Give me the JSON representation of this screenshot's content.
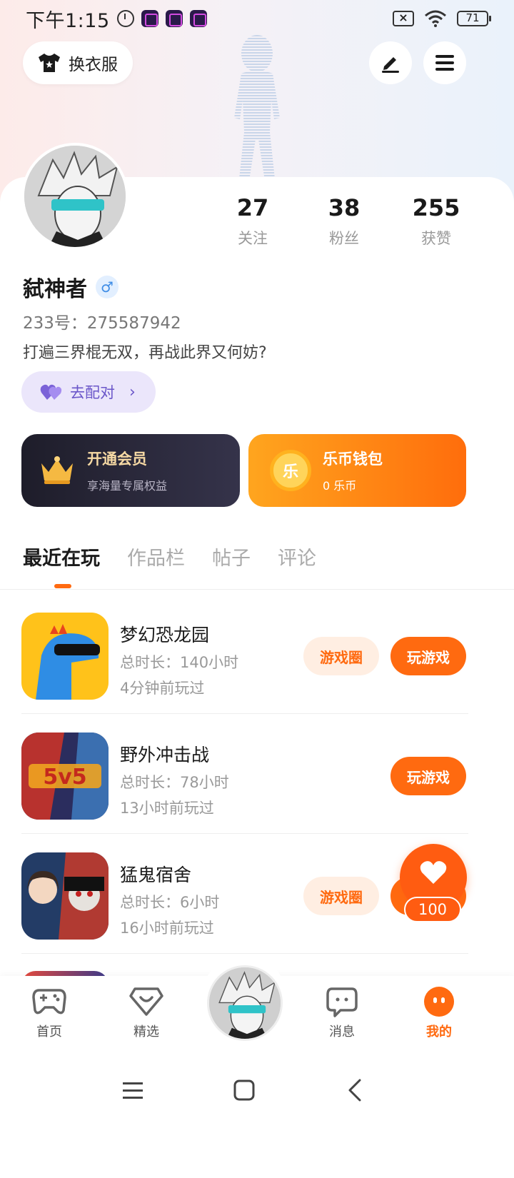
{
  "status_bar": {
    "time": "下午1:15",
    "battery": "71"
  },
  "top_bar": {
    "dress_label": "换衣服"
  },
  "profile": {
    "username": "弑神者",
    "gender_symbol": "♂",
    "uid": "233号：275587942",
    "bio": "打遍三界棍无双，再战此界又何妨?",
    "match_label": "去配对",
    "stats": [
      {
        "value": "27",
        "label": "关注"
      },
      {
        "value": "38",
        "label": "粉丝"
      },
      {
        "value": "255",
        "label": "获赞"
      }
    ]
  },
  "cards": {
    "vip_title": "开通会员",
    "vip_sub": "享海量专属权益",
    "wallet_title": "乐币钱包",
    "wallet_sub": "0 乐币",
    "coin_char": "乐"
  },
  "tabs": [
    {
      "label": "最近在玩",
      "active": true
    },
    {
      "label": "作品栏",
      "active": false
    },
    {
      "label": "帖子",
      "active": false
    },
    {
      "label": "评论",
      "active": false
    }
  ],
  "games": [
    {
      "name": "梦幻恐龙园",
      "time": "总时长：140小时",
      "last": "4分钟前玩过",
      "circle_label": "游戏圈",
      "play_label": "玩游戏"
    },
    {
      "name": "野外冲击战",
      "time": "总时长：78小时",
      "last": "13小时前玩过",
      "circle_label": "",
      "play_label": "玩游戏",
      "icon_text": "5v5"
    },
    {
      "name": "猛鬼宿舍",
      "time": "总时长：6小时",
      "last": "16小时前玩过",
      "circle_label": "游戏圈",
      "play_label": "玩游戏"
    }
  ],
  "like_bubble": {
    "count": "100"
  },
  "bottom_nav": [
    {
      "label": "首页",
      "icon": "gamepad-icon"
    },
    {
      "label": "精选",
      "icon": "heart-gem-icon"
    },
    {
      "label": "消息",
      "icon": "chat-bubble-icon"
    },
    {
      "label": "我的",
      "icon": "face-icon",
      "active": true
    }
  ],
  "colors": {
    "accent": "#ff6a10",
    "vip_gold": "#f6d9a4",
    "match_purple": "#6a56c9"
  }
}
